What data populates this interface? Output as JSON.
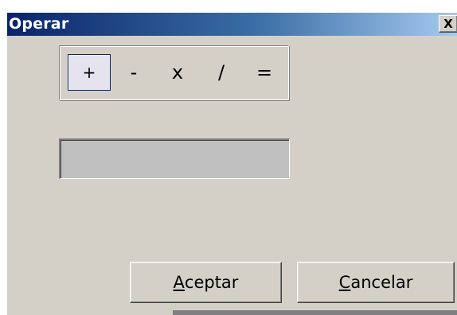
{
  "window": {
    "title": "Operar",
    "close_label": "X"
  },
  "operators": [
    {
      "label": "+",
      "selected": true
    },
    {
      "label": "-",
      "selected": false
    },
    {
      "label": "x",
      "selected": false
    },
    {
      "label": "/",
      "selected": false
    },
    {
      "label": "=",
      "selected": false
    }
  ],
  "result": {
    "value": ""
  },
  "buttons": {
    "accept": {
      "mnemonic": "A",
      "rest": "ceptar"
    },
    "cancel": {
      "mnemonic": "C",
      "rest": "ancelar"
    }
  },
  "colors": {
    "title_start": "#0a246a",
    "title_end": "#a6caf0",
    "face": "#d4d0c8",
    "field": "#c0c0c0"
  }
}
